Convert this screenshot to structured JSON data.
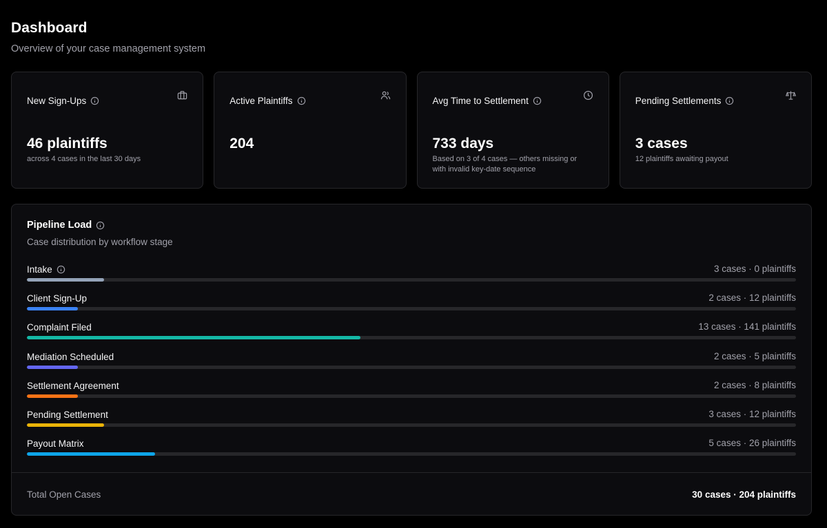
{
  "header": {
    "title": "Dashboard",
    "subtitle": "Overview of your case management system"
  },
  "cards": [
    {
      "title": "New Sign-Ups",
      "value": "46 plaintiffs",
      "note": "across 4 cases in the last 30 days",
      "icon": "briefcase-icon"
    },
    {
      "title": "Active Plaintiffs",
      "value": "204",
      "note": "",
      "icon": "users-icon"
    },
    {
      "title": "Avg Time to Settlement",
      "value": "733 days",
      "note": "Based on 3 of 4 cases — others missing or with invalid key-date sequence",
      "icon": "clock-icon"
    },
    {
      "title": "Pending Settlements",
      "value": "3 cases",
      "note": "12 plaintiffs awaiting payout",
      "icon": "scale-icon"
    }
  ],
  "pipeline": {
    "title": "Pipeline Load",
    "subtitle": "Case distribution by workflow stage",
    "stages": [
      {
        "name": "Intake",
        "stats": "3 cases · 0 plaintiffs",
        "cases": 3,
        "fraction": 0.1,
        "color": "#94a3b8",
        "has_info": true
      },
      {
        "name": "Client Sign-Up",
        "stats": "2 cases · 12 plaintiffs",
        "cases": 2,
        "fraction": 0.0667,
        "color": "#3b82f6",
        "has_info": false
      },
      {
        "name": "Complaint Filed",
        "stats": "13 cases · 141 plaintiffs",
        "cases": 13,
        "fraction": 0.4333,
        "color": "#14b8a6",
        "has_info": false
      },
      {
        "name": "Mediation Scheduled",
        "stats": "2 cases · 5 plaintiffs",
        "cases": 2,
        "fraction": 0.0667,
        "color": "#6366f1",
        "has_info": false
      },
      {
        "name": "Settlement Agreement",
        "stats": "2 cases · 8 plaintiffs",
        "cases": 2,
        "fraction": 0.0667,
        "color": "#f97316",
        "has_info": false
      },
      {
        "name": "Pending Settlement",
        "stats": "3 cases · 12 plaintiffs",
        "cases": 3,
        "fraction": 0.1,
        "color": "#eab308",
        "has_info": false
      },
      {
        "name": "Payout Matrix",
        "stats": "5 cases · 26 plaintiffs",
        "cases": 5,
        "fraction": 0.1667,
        "color": "#0ea5e9",
        "has_info": false
      }
    ],
    "total_label": "Total Open Cases",
    "total_value": "30 cases · 204 plaintiffs"
  },
  "colors": {
    "background": "#000000",
    "card": "#0c0c0f",
    "border": "#27272a",
    "muted_text": "#a1a1aa"
  }
}
